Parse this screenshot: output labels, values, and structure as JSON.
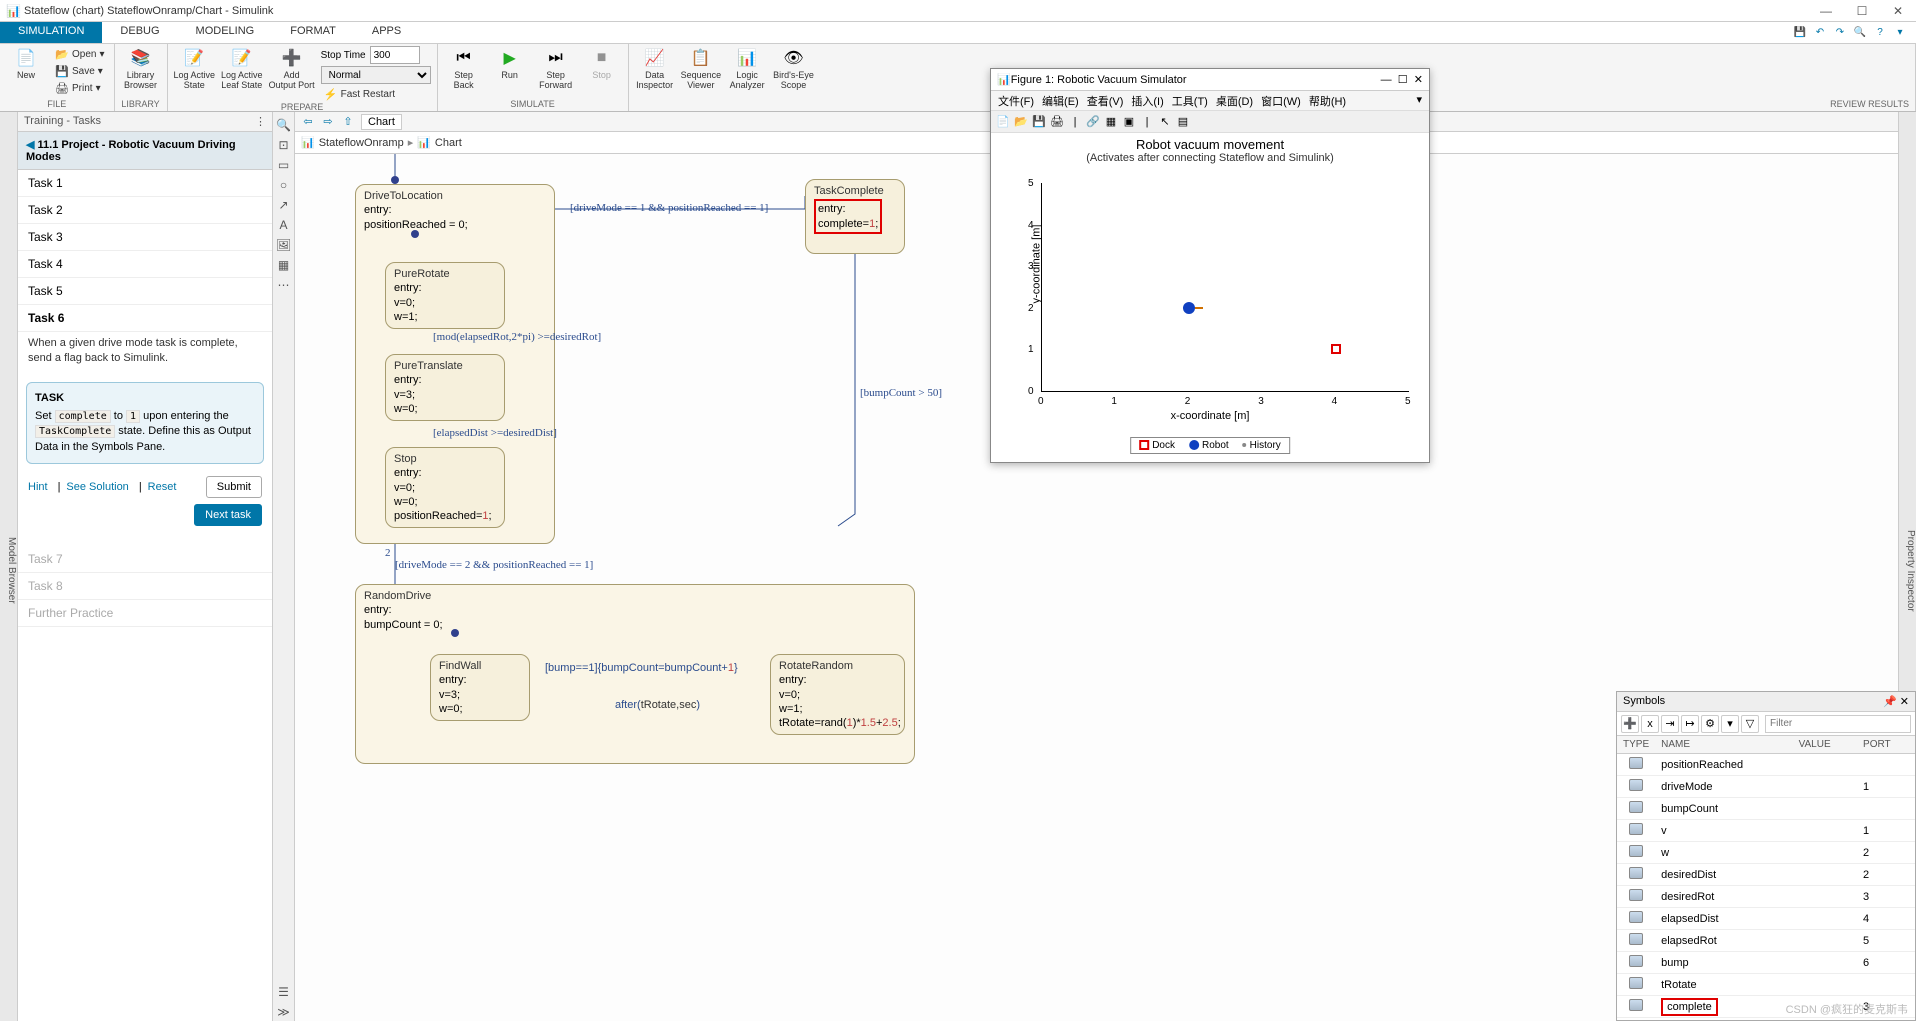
{
  "window": {
    "title": "Stateflow (chart) StateflowOnramp/Chart - Simulink"
  },
  "tabs": [
    "SIMULATION",
    "DEBUG",
    "MODELING",
    "FORMAT",
    "APPS"
  ],
  "ribbon": {
    "file": {
      "new": "New",
      "open": "Open",
      "save": "Save",
      "print": "Print",
      "label": "FILE"
    },
    "library": {
      "browser": "Library\nBrowser",
      "label": "LIBRARY"
    },
    "prepare": {
      "logActiveState": "Log Active\nState",
      "logLeaf": "Log Active\nLeaf State",
      "addOutput": "Add\nOutput Port",
      "stopTimeLabel": "Stop Time",
      "stopTime": "300",
      "mode": "Normal",
      "fastRestart": "Fast Restart",
      "label": "PREPARE"
    },
    "simulate": {
      "stepBack": "Step\nBack",
      "run": "Run",
      "stepFwd": "Step\nForward",
      "stop": "Stop",
      "label": "SIMULATE"
    },
    "review": {
      "dataInspector": "Data\nInspector",
      "seqViewer": "Sequence\nViewer",
      "logicAnalyzer": "Logic\nAnalyzer",
      "birdsEye": "Bird's-Eye\nScope",
      "label": "REVIEW RESULTS"
    }
  },
  "training": {
    "header": "Training - Tasks",
    "crumb": "11.1 Project - Robotic Vacuum Driving Modes",
    "tasks": [
      "Task 1",
      "Task 2",
      "Task 3",
      "Task 4",
      "Task 5",
      "Task 6"
    ],
    "desc": "When a given drive mode task is complete, send a flag back to Simulink.",
    "taskTitle": "TASK",
    "taskBody1": "Set ",
    "taskCode1": "complete",
    "taskBody2": " to ",
    "taskCode2": "1",
    "taskBody3": " upon entering the ",
    "taskCode3": "TaskComplete",
    "taskBody4": " state. Define this as Output Data in the Symbols Pane.",
    "hint": "Hint",
    "seeSolution": "See Solution",
    "reset": "Reset",
    "submit": "Submit",
    "next": "Next task",
    "after": [
      "Task 7",
      "Task 8",
      "Further Practice"
    ]
  },
  "canvas": {
    "tab": "Chart",
    "breadcrumb": [
      "StateflowOnramp",
      "Chart"
    ],
    "states": {
      "driveToLocation": {
        "name": "DriveToLocation",
        "body": "entry:\npositionReached = 0;"
      },
      "pureRotate": {
        "name": "PureRotate",
        "body": "entry:\nv=0;\nw=1;"
      },
      "pureTranslate": {
        "name": "PureTranslate",
        "body": "entry:\nv=3;\nw=0;"
      },
      "stop": {
        "name": "Stop",
        "body": "entry:\nv=0;\nw=0;\npositionReached=",
        "val": "1",
        "tail": ";"
      },
      "taskComplete": {
        "name": "TaskComplete",
        "body": "entry:\ncomplete=",
        "val": "1",
        "tail": ";"
      },
      "randomDrive": {
        "name": "RandomDrive",
        "body": "entry:\nbumpCount = 0;"
      },
      "findWall": {
        "name": "FindWall",
        "body": "entry:\nv=3;\nw=0;"
      },
      "rotateRandom": {
        "name": "RotateRandom",
        "body": "entry:\nv=0;\nw=1;\ntRotate=rand(",
        "val1": "1",
        "mid": ")*",
        "val2": "1.5",
        "plus": "+",
        "val3": "2.5",
        "tail": ";"
      }
    },
    "transitions": {
      "t1": "[driveMode == 1 && positionReached == 1]",
      "t2": "[mod(elapsedRot,2*pi) >=desiredRot]",
      "t3": "[elapsedDist >=desiredDist]",
      "t4": "[driveMode == 2 && positionReached == 1]",
      "t4num": "2",
      "t5": "[bumpCount > 50]",
      "t6a": "[bump==1]{bumpCount=bumpCount+",
      "t6v": "1",
      "t6b": "}",
      "t7a": "after(",
      "t7v": "tRotate,sec",
      "t7b": ")"
    }
  },
  "figure": {
    "title": "Figure 1: Robotic Vacuum Simulator",
    "menus": [
      "文件(F)",
      "编辑(E)",
      "查看(V)",
      "插入(I)",
      "工具(T)",
      "桌面(D)",
      "窗口(W)",
      "帮助(H)"
    ],
    "plotTitle": "Robot vacuum movement",
    "plotSub": "(Activates after connecting Stateflow and Simulink)",
    "xlabel": "x-coordinate [m]",
    "ylabel": "y-coordinate [m]",
    "legend": [
      "Dock",
      "Robot",
      "History"
    ]
  },
  "chart_data": {
    "type": "scatter",
    "title": "Robot vacuum movement",
    "xlabel": "x-coordinate [m]",
    "ylabel": "y-coordinate [m]",
    "xlim": [
      0,
      5
    ],
    "ylim": [
      0,
      5
    ],
    "xticks": [
      0,
      1,
      2,
      3,
      4,
      5
    ],
    "yticks": [
      0,
      1,
      2,
      3,
      4,
      5
    ],
    "series": [
      {
        "name": "Dock",
        "marker": "square-open",
        "color": "#e00000",
        "points": [
          [
            4,
            1
          ]
        ]
      },
      {
        "name": "Robot",
        "marker": "circle",
        "color": "#1040c0",
        "points": [
          [
            2,
            2
          ]
        ]
      },
      {
        "name": "History",
        "marker": "dot",
        "color": "#808080",
        "points": []
      }
    ]
  },
  "symbols": {
    "title": "Symbols",
    "filter": "Filter",
    "cols": [
      "TYPE",
      "NAME",
      "VALUE",
      "PORT"
    ],
    "rows": [
      {
        "name": "positionReached",
        "value": "",
        "port": ""
      },
      {
        "name": "driveMode",
        "value": "",
        "port": "1"
      },
      {
        "name": "bumpCount",
        "value": "",
        "port": ""
      },
      {
        "name": "v",
        "value": "",
        "port": "1"
      },
      {
        "name": "w",
        "value": "",
        "port": "2"
      },
      {
        "name": "desiredDist",
        "value": "",
        "port": "2"
      },
      {
        "name": "desiredRot",
        "value": "",
        "port": "3"
      },
      {
        "name": "elapsedDist",
        "value": "",
        "port": "4"
      },
      {
        "name": "elapsedRot",
        "value": "",
        "port": "5"
      },
      {
        "name": "bump",
        "value": "",
        "port": "6"
      },
      {
        "name": "tRotate",
        "value": "",
        "port": ""
      },
      {
        "name": "complete",
        "value": "",
        "port": "3",
        "hl": true
      }
    ]
  },
  "watermark": "CSDN @疯狂的麦克斯韦",
  "leftgutter": "Model Browser",
  "rightgutter": "Property Inspector"
}
